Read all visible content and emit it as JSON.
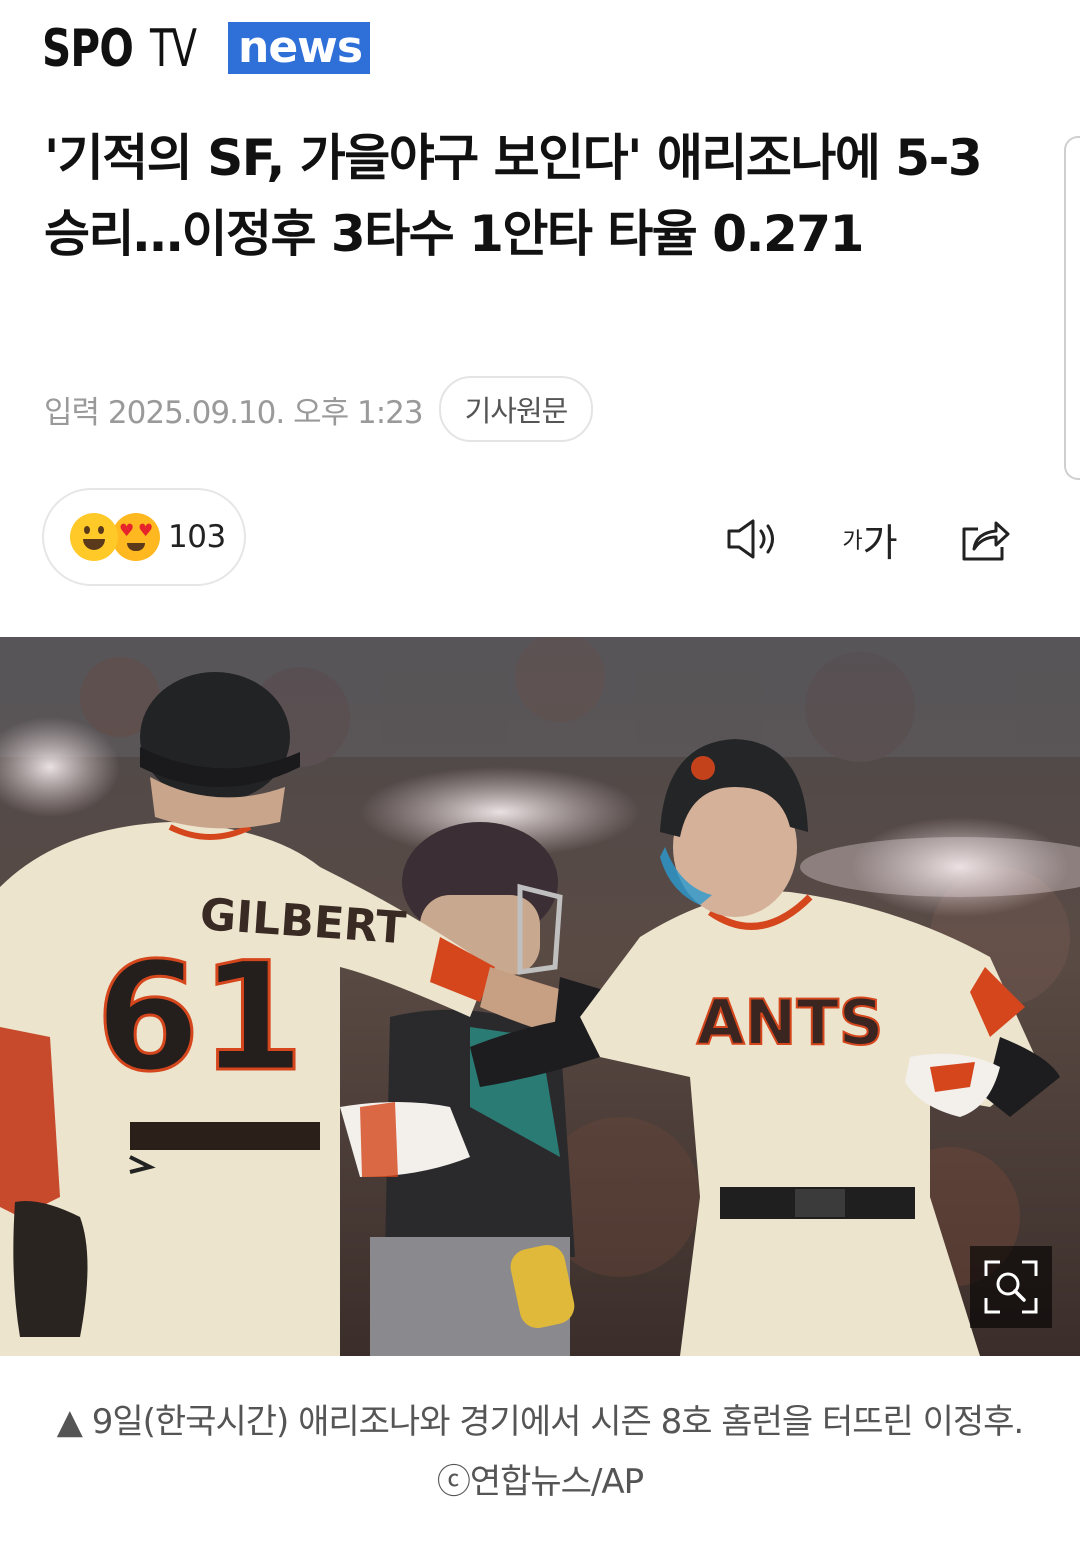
{
  "brand": {
    "logo_spo": "SPO",
    "logo_tv": "TV",
    "logo_news": "news"
  },
  "article": {
    "headline": "'기적의 SF, 가을야구 보인다' 애리조나에 5-3 승리…이정후 3타수 1안타 타율 0.271",
    "date": "입력 2025.09.10. 오후 1:23",
    "origin_button": "기사원문"
  },
  "reactions": {
    "count": "103",
    "icons": [
      "grinning-face-icon",
      "heart-eyes-face-icon"
    ]
  },
  "toolbar": {
    "audio_icon": "speaker-icon",
    "font_size_small": "가",
    "font_size_large": "가",
    "share_icon": "share-icon"
  },
  "photo": {
    "jersey_name": "GILBERT",
    "jersey_number": "61",
    "jersey_team": "ANTS",
    "zoom_icon": "zoom-icon"
  },
  "caption": {
    "text": "▲ 9일(한국시간) 애리조나와 경기에서 시즌 8호 홈런을 터뜨린 이정후. ⓒ연합뉴스/AP"
  },
  "colors": {
    "news_blue": "#2f6fd8",
    "giants_orange": "#d5461c",
    "jersey_cream": "#ece4cd"
  }
}
